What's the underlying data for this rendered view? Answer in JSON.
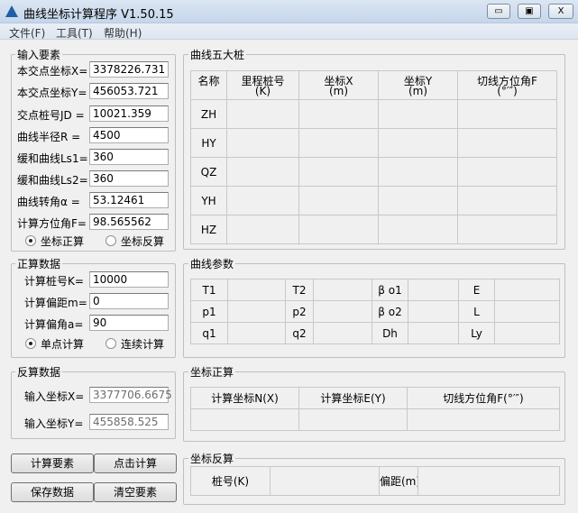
{
  "window": {
    "title": "曲线坐标计算程序 V1.50.15",
    "min": "▭",
    "max": "▣",
    "close": "X"
  },
  "menu": [
    "文件(F)",
    "工具(T)",
    "帮助(H)"
  ],
  "input_group": {
    "title": "输入要素",
    "fields": [
      {
        "label": "本交点坐标X=",
        "value": "3378226.731"
      },
      {
        "label": "本交点坐标Y=",
        "value": "456053.721"
      },
      {
        "label": "交点桩号JD =",
        "value": "10021.359"
      },
      {
        "label": "曲线半径R  =",
        "value": "4500"
      },
      {
        "label": "缓和曲线Ls1=",
        "value": "360"
      },
      {
        "label": "缓和曲线Ls2=",
        "value": "360"
      },
      {
        "label": "曲线转角α =",
        "value": "53.12461"
      },
      {
        "label": "计算方位角F=",
        "value": "98.565562"
      }
    ],
    "radios": [
      {
        "label": "坐标正算",
        "checked": true
      },
      {
        "label": "坐标反算",
        "checked": false
      }
    ]
  },
  "forward_group": {
    "title": "正算数据",
    "fields": [
      {
        "label": "计算桩号K=",
        "value": "10000"
      },
      {
        "label": "计算偏距m=",
        "value": "0"
      },
      {
        "label": "计算偏角a=",
        "value": "90"
      }
    ],
    "radios": [
      {
        "label": "单点计算",
        "checked": true
      },
      {
        "label": "连续计算",
        "checked": false
      }
    ]
  },
  "inverse_group": {
    "title": "反算数据",
    "fields": [
      {
        "label": "输入坐标X=",
        "value": "3377706.6675"
      },
      {
        "label": "输入坐标Y=",
        "value": "455858.525"
      }
    ]
  },
  "buttons": [
    "计算要素",
    "点击计算",
    "保存数据",
    "清空要素"
  ],
  "five_stakes": {
    "title": "曲线五大桩",
    "headers": [
      [
        "名称",
        ""
      ],
      [
        "里程桩号",
        "(K)"
      ],
      [
        "坐标X",
        "(m)"
      ],
      [
        "坐标Y",
        "(m)"
      ],
      [
        "切线方位角F",
        "(°′″)"
      ]
    ],
    "rows": [
      "ZH",
      "HY",
      "QZ",
      "YH",
      "HZ"
    ]
  },
  "params": {
    "title": "曲线参数",
    "rows": [
      [
        "T1",
        "T2",
        "β o1",
        "E"
      ],
      [
        "p1",
        "p2",
        "β o2",
        "L"
      ],
      [
        "q1",
        "q2",
        "Dh",
        "Ly"
      ]
    ]
  },
  "coord_forward": {
    "title": "坐标正算",
    "headers": [
      "计算坐标N(X)",
      "计算坐标E(Y)",
      "切线方位角F(°′″)"
    ]
  },
  "coord_inverse": {
    "title": "坐标反算",
    "labels": [
      "桩号(K)",
      "偏距(m)"
    ]
  }
}
